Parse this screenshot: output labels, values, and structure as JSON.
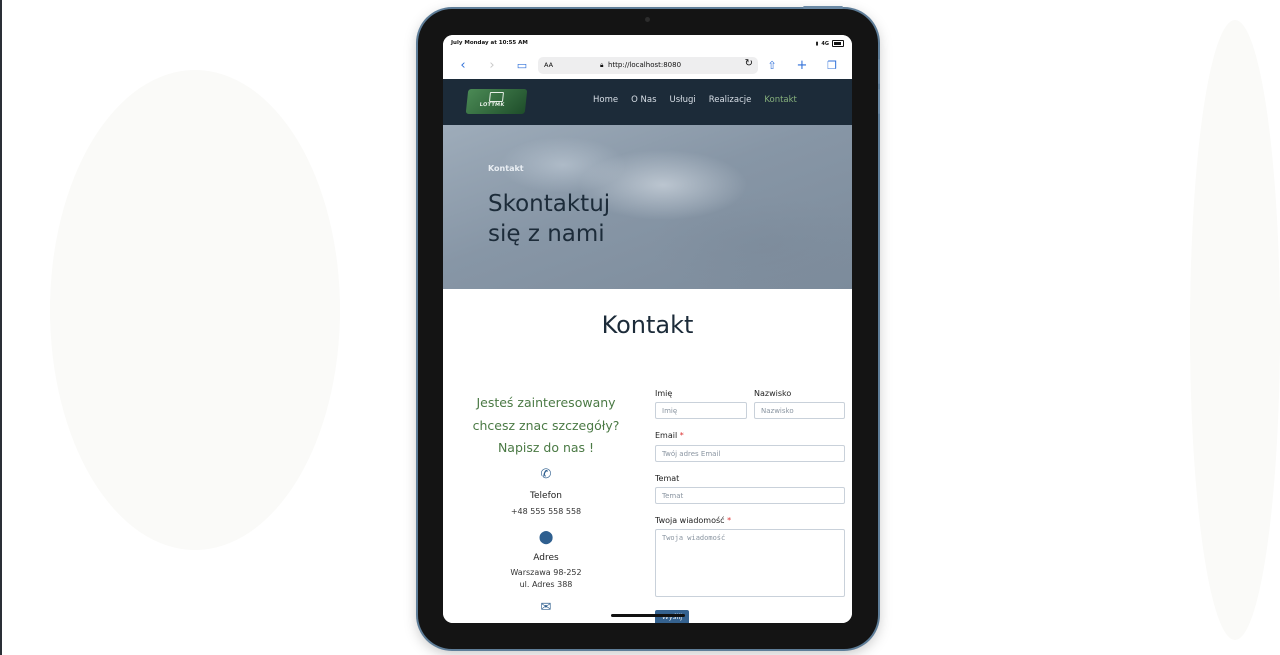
{
  "device": {
    "status_time": "July Monday at 10:55 AM",
    "status_network": "4G"
  },
  "browser": {
    "aa_label": "AA",
    "url": "http://localhost:8080"
  },
  "nav": {
    "logo_text": "LOTTMK",
    "links": [
      "Home",
      "O Nas",
      "Usługi",
      "Realizacje",
      "Kontakt"
    ],
    "active": "Kontakt"
  },
  "hero": {
    "breadcrumb": "Kontakt",
    "title_line1": "Skontaktuj",
    "title_line2": "się z nami"
  },
  "contact": {
    "section_title": "Kontakt",
    "lead_line1": "Jesteś zainteresowany",
    "lead_line2": "chcesz znac szczegóły?",
    "lead_line3": "Napisz do nas !",
    "phone_label": "Telefon",
    "phone_value": "+48 555 558 558",
    "address_label": "Adres",
    "address_line1": "Warszawa 98-252",
    "address_line2": "ul. Adres 388"
  },
  "form": {
    "first_name_label": "Imię",
    "first_name_placeholder": "Imię",
    "last_name_label": "Nazwisko",
    "last_name_placeholder": "Nazwisko",
    "email_label": "Email",
    "email_placeholder": "Twój adres Email",
    "subject_label": "Temat",
    "subject_placeholder": "Temat",
    "message_label": "Twoja wiadomość",
    "message_placeholder": "Twoja wiadomość",
    "required_mark": "*",
    "submit_label": "Wyślij"
  }
}
